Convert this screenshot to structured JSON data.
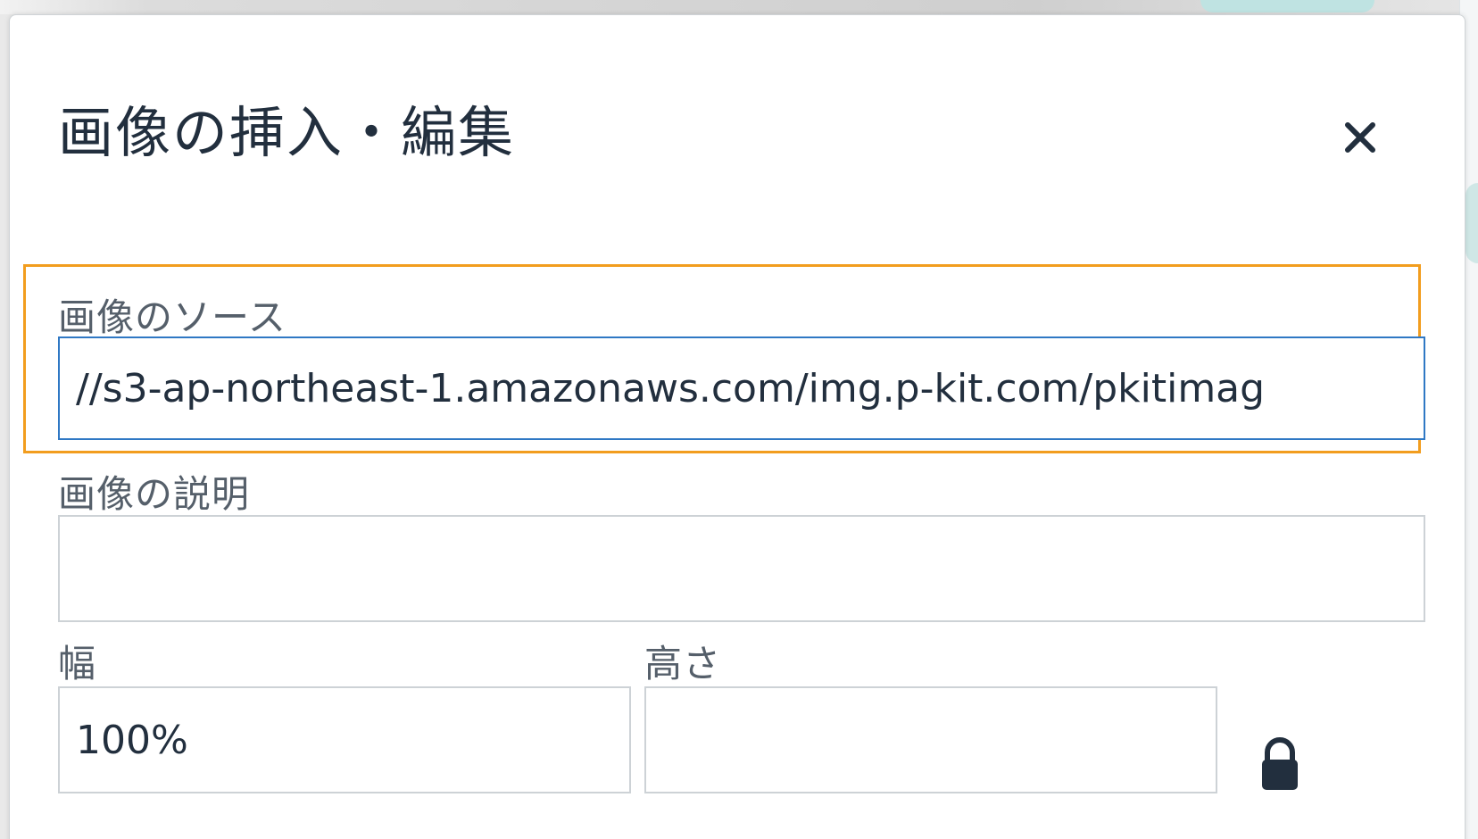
{
  "dialog": {
    "title": "画像の挿入・編集",
    "close_icon": "close-icon"
  },
  "source": {
    "label": "画像のソース",
    "value": "//s3-ap-northeast-1.amazonaws.com/img.p-kit.com/pkitimag"
  },
  "description": {
    "label": "画像の説明",
    "value": ""
  },
  "dimensions": {
    "width_label": "幅",
    "width_value": "100%",
    "height_label": "高さ",
    "height_value": "",
    "lock_icon": "lock-icon"
  },
  "colors": {
    "highlight": "#f29d1e",
    "focus_border": "#2f78c4",
    "text": "#222f3e",
    "label": "#555f6a"
  }
}
